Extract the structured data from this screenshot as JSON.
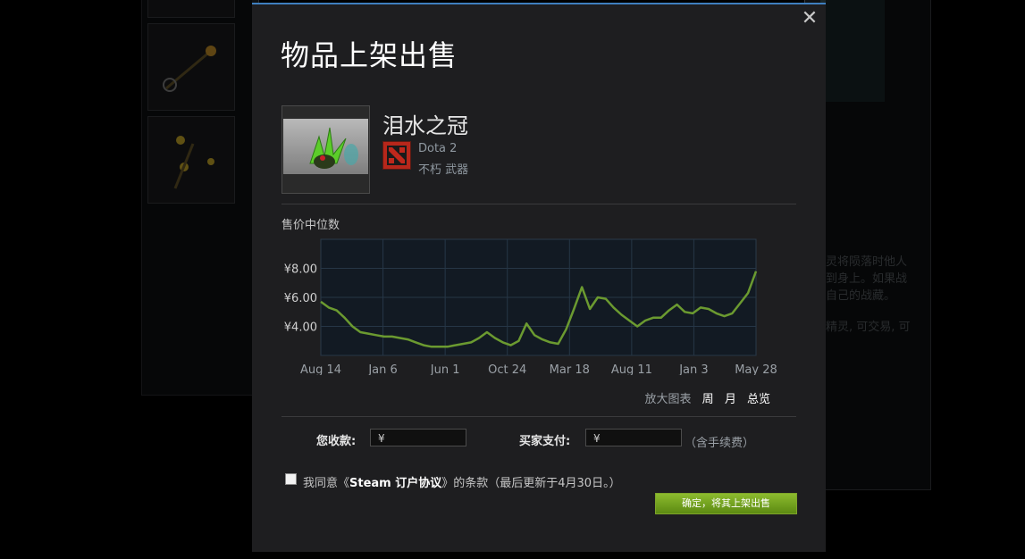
{
  "dialog": {
    "title": "物品上架出售",
    "close_glyph": "✕"
  },
  "item": {
    "name": "泪水之冠",
    "game": "Dota 2",
    "type": "不朽 武器"
  },
  "chart_data": {
    "type": "line",
    "title": "售价中位数",
    "xlabel": "",
    "ylabel": "",
    "x_ticks": [
      "Aug 14",
      "Jan 6",
      "Jun 1",
      "Oct 24",
      "Mar 18",
      "Aug 11",
      "Jan 3",
      "May 28"
    ],
    "y_ticks": [
      "¥8.00",
      "¥6.00",
      "¥4.00"
    ],
    "ylim": [
      2.0,
      10.0
    ],
    "grid": true,
    "line_color": "#6b9a30",
    "series": [
      {
        "values": [
          5.7,
          5.3,
          5.1,
          4.6,
          4.0,
          3.6,
          3.5,
          3.4,
          3.3,
          3.3,
          3.2,
          3.1,
          2.9,
          2.7,
          2.6,
          2.6,
          2.6,
          2.7,
          2.8,
          2.9,
          3.2,
          3.6,
          3.2,
          2.9,
          2.7,
          3.0,
          4.2,
          3.4,
          3.1,
          2.9,
          2.8,
          3.8,
          5.2,
          6.7,
          5.2,
          6.0,
          5.9,
          5.3,
          4.8,
          4.4,
          4.0,
          4.4,
          4.6,
          4.6,
          5.1,
          5.5,
          5.0,
          4.9,
          5.3,
          5.2,
          4.9,
          4.7,
          4.9,
          5.6,
          6.3,
          7.8
        ]
      }
    ]
  },
  "zoom": {
    "label": "放大图表",
    "options": [
      "周",
      "月",
      "总览"
    ]
  },
  "pricing": {
    "receive_label": "您收款:",
    "receive_value": "¥",
    "pay_label": "买家支付:",
    "pay_value": "¥",
    "fee_note": "（含手续费）"
  },
  "agreement": {
    "prefix": "我同意《",
    "link": "Steam 订户协议",
    "suffix": "》的条款（最后更新于4月30日。）"
  },
  "confirm_button": "确定，将其上架出售"
}
